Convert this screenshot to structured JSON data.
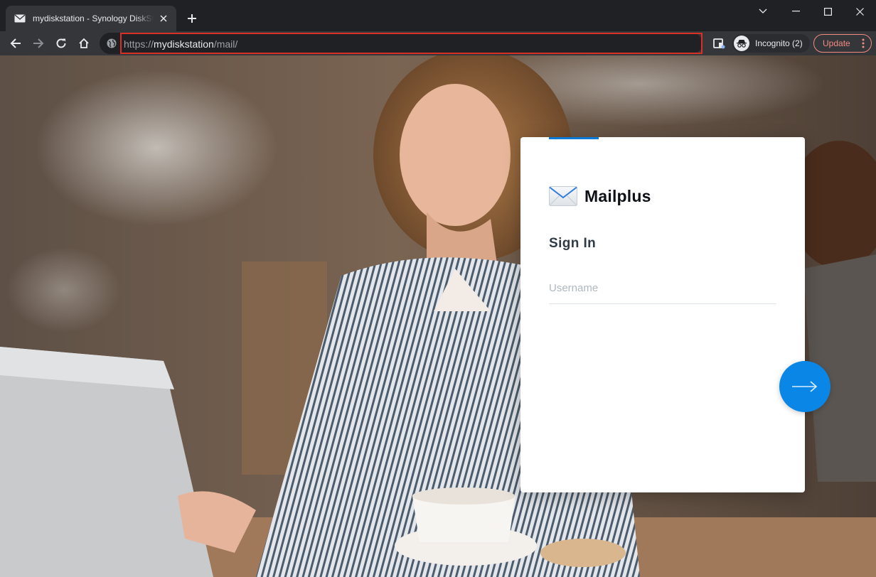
{
  "browser": {
    "tab": {
      "title": "mydiskstation - Synology DiskStation",
      "favicon": "mail-icon"
    },
    "address_bar": {
      "scheme": "https://",
      "host": "mydiskstation",
      "path": "/mail/"
    },
    "incognito_label": "Incognito (2)",
    "update_label": "Update",
    "colors": {
      "chrome_dark": "#202124",
      "chrome_toolbar": "#35363a",
      "highlight": "#d93025",
      "update": "#f28b82"
    }
  },
  "login": {
    "brand_name": "Mailplus",
    "title": "Sign In",
    "username_placeholder": "Username",
    "colors": {
      "accent": "#0a7ad8",
      "button": "#0a86e6"
    }
  }
}
